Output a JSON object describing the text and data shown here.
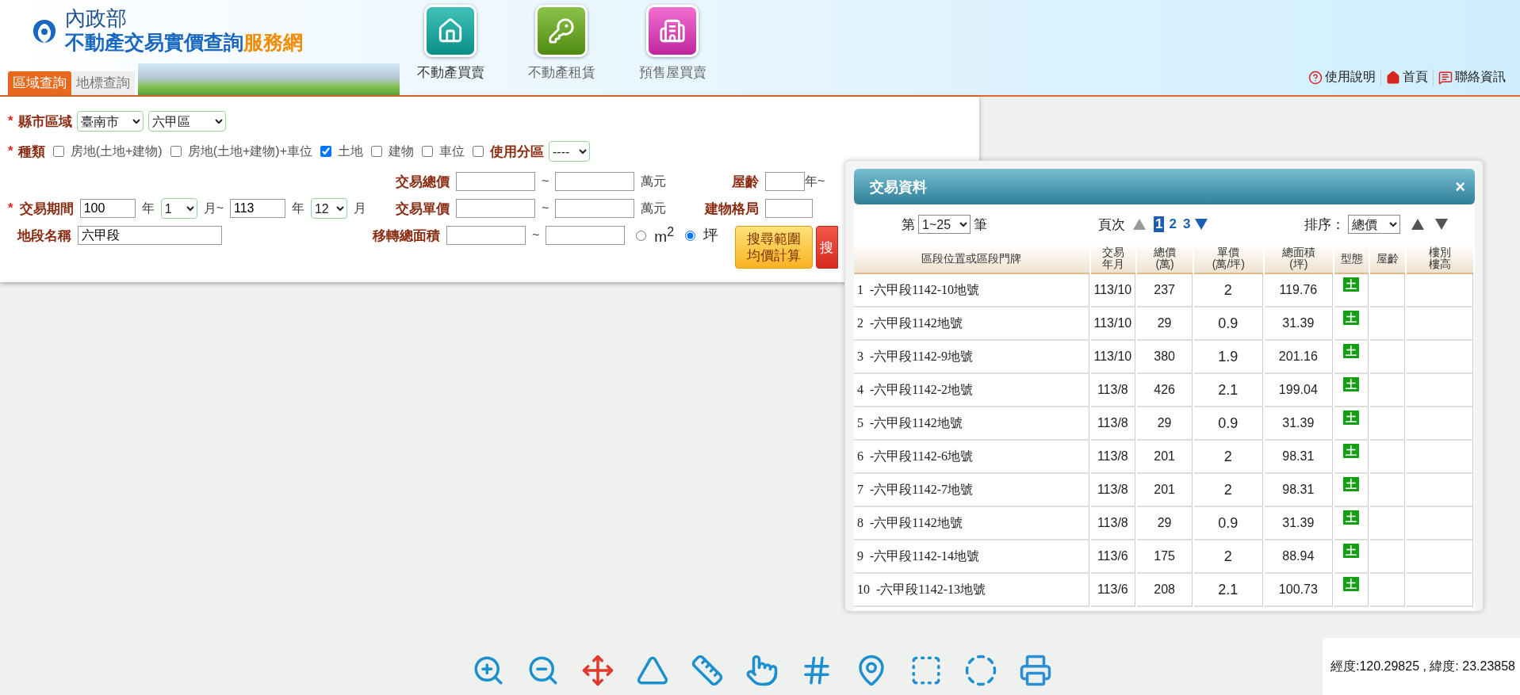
{
  "header": {
    "agency": "內政部",
    "site_title": "不動產交易實價查詢",
    "site_title_suffix": "服務網",
    "search_tabs": [
      {
        "label": "區域查詢",
        "selected": true
      },
      {
        "label": "地標查詢",
        "selected": false
      }
    ],
    "categories": [
      {
        "label": "不動產買賣",
        "kind": "sale",
        "selected": true
      },
      {
        "label": "不動產租賃",
        "kind": "rent",
        "selected": false
      },
      {
        "label": "預售屋買賣",
        "kind": "presale",
        "selected": false
      }
    ],
    "links": [
      {
        "label": "使用說明",
        "kind": "help"
      },
      {
        "label": "首頁",
        "kind": "home"
      },
      {
        "label": "聯絡資訊",
        "kind": "contact"
      }
    ]
  },
  "form": {
    "region": {
      "mark": "*",
      "label": "縣市區域",
      "city": "臺南市",
      "district": "六甲區"
    },
    "types": {
      "mark": "*",
      "label": "種類",
      "options": [
        {
          "label": "房地(土地+建物)",
          "checked": false
        },
        {
          "label": "房地(土地+建物)+車位",
          "checked": false
        },
        {
          "label": "土地",
          "checked": true
        },
        {
          "label": "建物",
          "checked": false
        },
        {
          "label": "車位",
          "checked": false
        }
      ],
      "zoning": {
        "label": "使用分區",
        "checked": false,
        "value": "----"
      }
    },
    "total_price": {
      "label": "交易總價",
      "separator": "~",
      "unit": "萬元"
    },
    "age": {
      "label": "屋齡",
      "unit": "年~"
    },
    "period": {
      "mark": "*",
      "label": "交易期間",
      "from_year": "100",
      "from_year_unit": "年",
      "from_month": "1",
      "from_month_unit": "月~",
      "to_year": "113",
      "to_year_unit": "年",
      "to_month": "12",
      "to_month_unit": "月"
    },
    "unit_price": {
      "label": "交易單價",
      "separator": "~",
      "unit": "萬元"
    },
    "layout": {
      "label": "建物格局"
    },
    "section": {
      "label": "地段名稱",
      "value": "六甲段"
    },
    "area": {
      "label": "移轉總面積",
      "separator": "~",
      "units": [
        {
          "label": "m$^{2}$",
          "selected": false
        },
        {
          "label": "坪",
          "selected": true
        }
      ]
    },
    "buttons": [
      {
        "label": "搜尋範圍均價計算",
        "kind": "average"
      },
      {
        "label": "搜",
        "kind": "search"
      }
    ]
  },
  "dialog": {
    "title": "交易資料",
    "close": "×",
    "page_size": {
      "prefix": "第",
      "value": "1~25",
      "suffix": "筆"
    },
    "pager": {
      "label": "頁次",
      "prev_enabled": false,
      "next_enabled": true,
      "pages": [
        {
          "label": "1",
          "selected": true
        },
        {
          "label": "2",
          "selected": false
        },
        {
          "label": "3",
          "selected": false
        }
      ]
    },
    "sort": {
      "label": "排序：",
      "value": "總價"
    },
    "table": {
      "columns": [
        [
          "區段位置或區段門牌"
        ],
        [
          "交易",
          "年月"
        ],
        [
          "總價",
          "(萬)"
        ],
        [
          "單價",
          "(萬/坪)"
        ],
        [
          "總面積",
          "(坪)"
        ],
        [
          "型態"
        ],
        [
          "屋齡"
        ],
        [
          "樓別",
          "樓高"
        ]
      ],
      "rows": [
        {
          "location": "1  -六甲段1142-10地號",
          "date": "113/10",
          "total": "237",
          "unit_price": "2",
          "area": "119.76",
          "type": "土"
        },
        {
          "location": "2  -六甲段1142地號",
          "date": "113/10",
          "total": "29",
          "unit_price": "0.9",
          "area": "31.39",
          "type": "土"
        },
        {
          "location": "3  -六甲段1142-9地號",
          "date": "113/10",
          "total": "380",
          "unit_price": "1.9",
          "area": "201.16",
          "type": "土"
        },
        {
          "location": "4  -六甲段1142-2地號",
          "date": "113/8",
          "total": "426",
          "unit_price": "2.1",
          "area": "199.04",
          "type": "土"
        },
        {
          "location": "5  -六甲段1142地號",
          "date": "113/8",
          "total": "29",
          "unit_price": "0.9",
          "area": "31.39",
          "type": "土"
        },
        {
          "location": "6  -六甲段1142-6地號",
          "date": "113/8",
          "total": "201",
          "unit_price": "2",
          "area": "98.31",
          "type": "土"
        },
        {
          "location": "7  -六甲段1142-7地號",
          "date": "113/8",
          "total": "201",
          "unit_price": "2",
          "area": "98.31",
          "type": "土"
        },
        {
          "location": "8  -六甲段1142地號",
          "date": "113/8",
          "total": "29",
          "unit_price": "0.9",
          "area": "31.39",
          "type": "土"
        },
        {
          "location": "9  -六甲段1142-14地號",
          "date": "113/6",
          "total": "175",
          "unit_price": "2",
          "area": "88.94",
          "type": "土"
        },
        {
          "location": "10  -六甲段1142-13地號",
          "date": "113/6",
          "total": "208",
          "unit_price": "2.1",
          "area": "100.73",
          "type": "土"
        }
      ]
    }
  },
  "status_bar": {
    "coordinates": "經度:120.29825 , 緯度: 23.23858"
  }
}
